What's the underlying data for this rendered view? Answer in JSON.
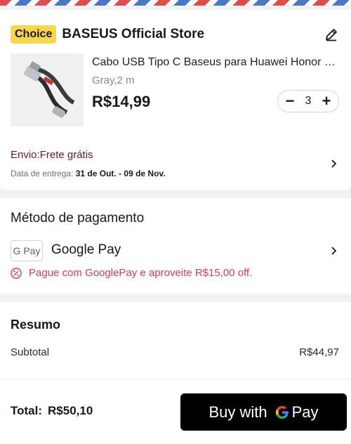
{
  "store": {
    "badge": "Choice",
    "name": "BASEUS Official Store",
    "edit_icon": "pencil-icon"
  },
  "product": {
    "title": "Cabo USB Tipo C Baseus para Huawei Honor Xiaomi",
    "variant": "Gray,2 m",
    "price": "R$14,99",
    "quantity": "3",
    "decrement_label": "−",
    "increment_label": "+"
  },
  "shipping": {
    "label": "Envio:Frete grátis",
    "delivery_label": "Data de entrega: ",
    "delivery_range": "31 de Out. - 09 de Nov."
  },
  "payment": {
    "title": "Método de pagamento",
    "chip": "G Pay",
    "method": "Google Pay",
    "promo": "Pague com GooglePay e aproveite R$15,00 off."
  },
  "summary": {
    "title": "Resumo",
    "subtotal_label": "Subtotal",
    "subtotal_value": "R$44,97"
  },
  "footer": {
    "total_label": "Total:",
    "total_value": "R$50,10",
    "buy_prefix": "Buy with",
    "buy_suffix": "Pay"
  },
  "colors": {
    "accent_choice": "#f9d648",
    "shipping_text": "#6b1733",
    "promo_text": "#d23b5a",
    "button_bg": "#000000"
  }
}
